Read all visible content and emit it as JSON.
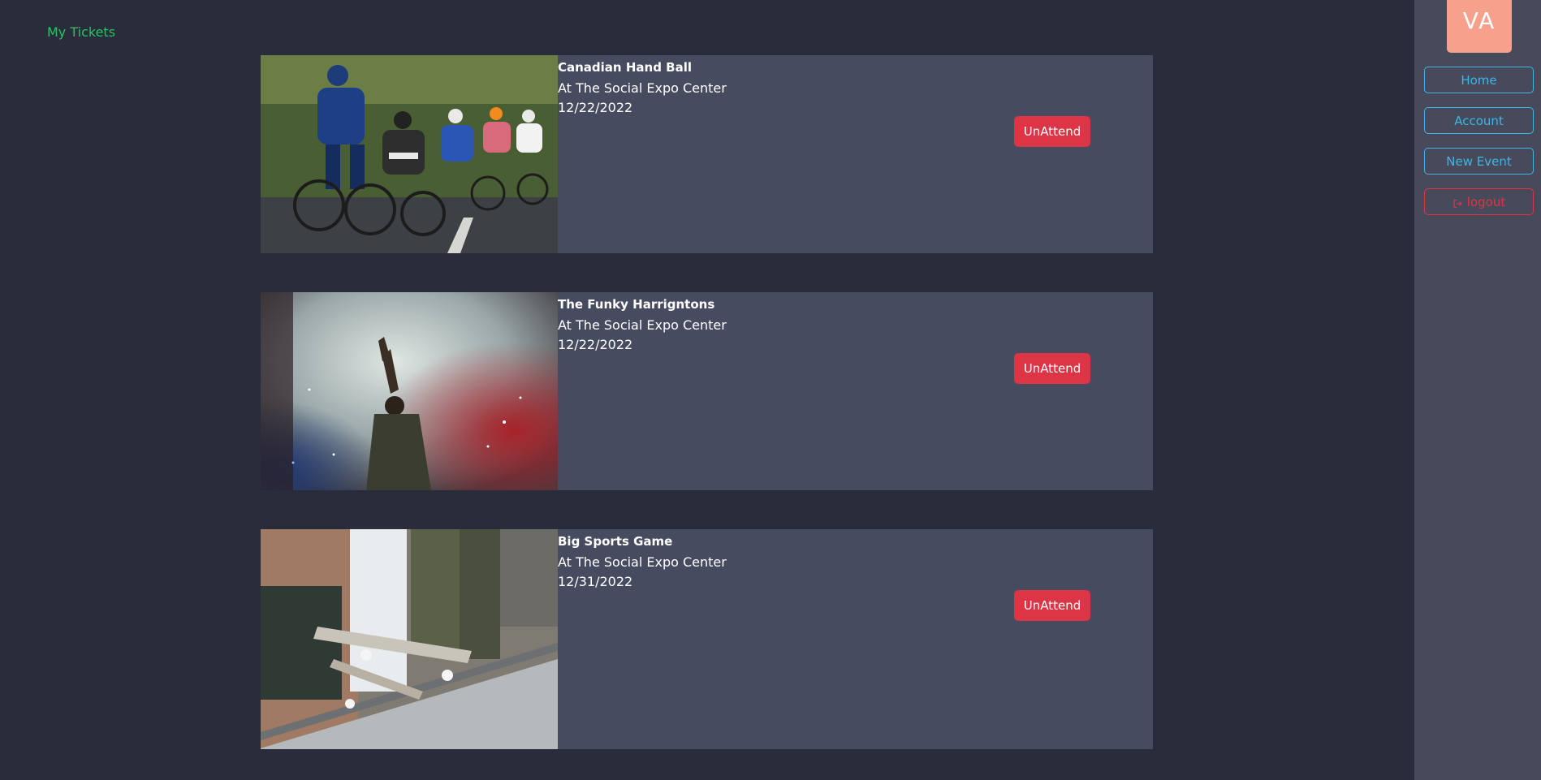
{
  "page": {
    "title": "My Tickets"
  },
  "tickets": [
    {
      "name": "Canadian Hand Ball",
      "venue": "At The Social Expo Center",
      "date": "12/22/2022",
      "action_label": "UnAttend",
      "image_icon": "cycling-race-photo"
    },
    {
      "name": "The Funky Harrigntons",
      "venue": "At The Social Expo Center",
      "date": "12/22/2022",
      "action_label": "UnAttend",
      "image_icon": "concert-smoke-photo"
    },
    {
      "name": "Big Sports Game",
      "venue": "At The Social Expo Center",
      "date": "12/31/2022",
      "action_label": "UnAttend",
      "image_icon": "skateboard-photo"
    }
  ],
  "sidebar": {
    "avatar_initials": "VA",
    "items": [
      {
        "label": "Home"
      },
      {
        "label": "Account"
      },
      {
        "label": "New Event"
      }
    ],
    "logout_label": "logout",
    "logout_icon": "sign-out-icon"
  },
  "colors": {
    "background": "#292d3b",
    "card": "#474b5f",
    "sidebar": "#464a5a",
    "title_green": "#22c55e",
    "danger": "#dc3545",
    "nav_blue": "#3fb5e8",
    "avatar": "#f7a08c"
  }
}
